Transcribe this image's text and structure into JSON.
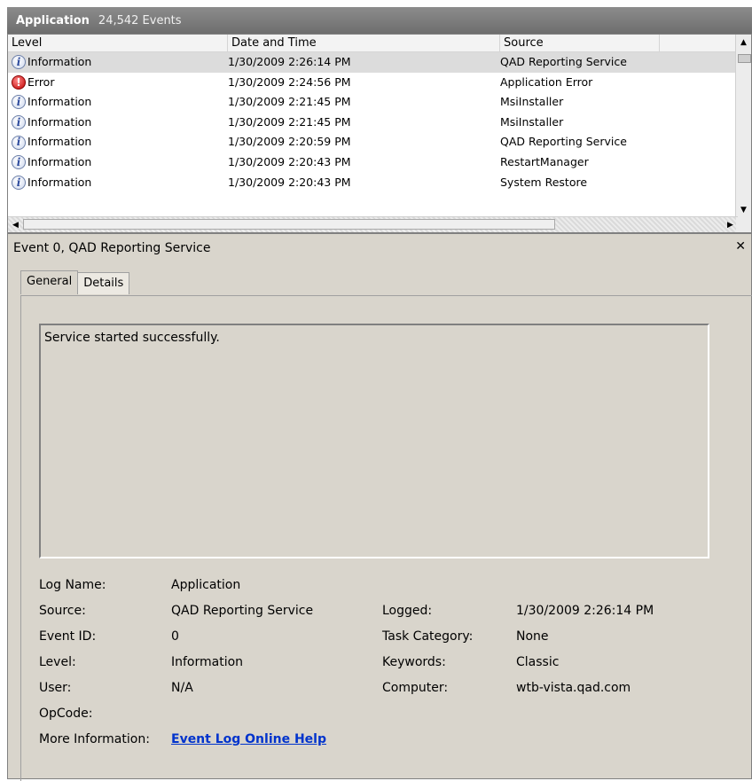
{
  "header": {
    "title": "Application",
    "count": "24,542 Events"
  },
  "list": {
    "columns": [
      "Level",
      "Date and Time",
      "Source"
    ],
    "rows": [
      {
        "level": "Information",
        "icon": "info-icon",
        "datetime": "1/30/2009 2:26:14 PM",
        "source": "QAD Reporting Service"
      },
      {
        "level": "Error",
        "icon": "error-icon",
        "datetime": "1/30/2009 2:24:56 PM",
        "source": "Application Error"
      },
      {
        "level": "Information",
        "icon": "info-icon",
        "datetime": "1/30/2009 2:21:45 PM",
        "source": "MsiInstaller"
      },
      {
        "level": "Information",
        "icon": "info-icon",
        "datetime": "1/30/2009 2:21:45 PM",
        "source": "MsiInstaller"
      },
      {
        "level": "Information",
        "icon": "info-icon",
        "datetime": "1/30/2009 2:20:59 PM",
        "source": "QAD Reporting Service"
      },
      {
        "level": "Information",
        "icon": "info-icon",
        "datetime": "1/30/2009 2:20:43 PM",
        "source": "RestartManager"
      },
      {
        "level": "Information",
        "icon": "info-icon",
        "datetime": "1/30/2009 2:20:43 PM",
        "source": "System Restore"
      }
    ]
  },
  "details": {
    "title": "Event 0, QAD Reporting Service",
    "tabs": [
      "General",
      "Details"
    ],
    "message": "Service started successfully.",
    "labels": {
      "log_name": "Log Name:",
      "source": "Source:",
      "event_id": "Event ID:",
      "level": "Level:",
      "user": "User:",
      "opcode": "OpCode:",
      "more_info": "More Information:",
      "logged": "Logged:",
      "task_category": "Task Category:",
      "keywords": "Keywords:",
      "computer": "Computer:"
    },
    "values": {
      "log_name": "Application",
      "source": "QAD Reporting Service",
      "event_id": "0",
      "level": "Information",
      "user": "N/A",
      "opcode": "",
      "more_info": "Event Log Online Help",
      "logged": "1/30/2009 2:26:14 PM",
      "task_category": "None",
      "keywords": "Classic",
      "computer": "wtb-vista.qad.com"
    }
  }
}
